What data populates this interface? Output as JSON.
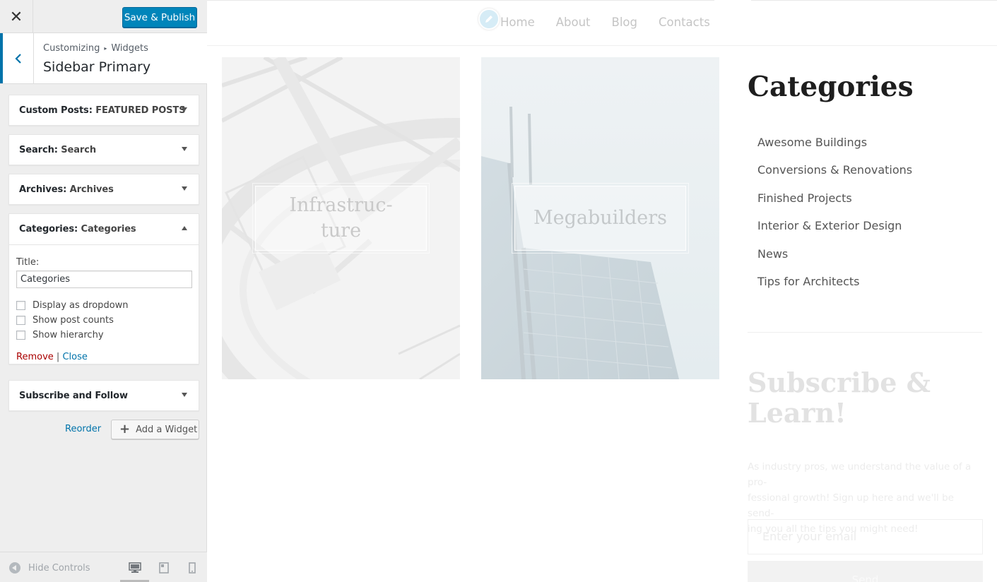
{
  "header": {
    "close_symbol": "✕",
    "publish_label": "Save & Publish"
  },
  "section": {
    "breadcrumb_root": "Customizing",
    "breadcrumb_sep": "▸",
    "breadcrumb_leaf": "Widgets",
    "title": "Sidebar Primary"
  },
  "widgets": [
    {
      "type": "Custom Posts:",
      "instance": "FEATURED POSTS",
      "expanded": false
    },
    {
      "type": "Search:",
      "instance": "Search",
      "expanded": false
    },
    {
      "type": "Archives:",
      "instance": "Archives",
      "expanded": false
    },
    {
      "type": "Categories:",
      "instance": "Categories",
      "expanded": true
    },
    {
      "type": "Subscribe and Follow",
      "instance": "",
      "expanded": false
    }
  ],
  "categories_form": {
    "title_label": "Title:",
    "title_value": "Categories",
    "options": [
      {
        "label": "Display as dropdown",
        "checked": false
      },
      {
        "label": "Show post counts",
        "checked": false
      },
      {
        "label": "Show hierarchy",
        "checked": false
      }
    ],
    "remove_label": "Remove",
    "link_sep": "|",
    "close_label": "Close"
  },
  "actions": {
    "reorder_label": "Reorder",
    "add_widget_label": "Add a Widget"
  },
  "footer": {
    "hide_controls_label": "Hide Controls",
    "devices": [
      "desktop-icon",
      "tablet-icon",
      "mobile-icon"
    ],
    "active_device": "desktop"
  },
  "preview": {
    "nav": [
      "Home",
      "About",
      "Blog",
      "Contacts"
    ],
    "cards": [
      {
        "line1": "Infrastruc-",
        "line2": "ture"
      },
      {
        "line1": "Megabuilders",
        "line2": ""
      }
    ],
    "categories_heading": "Categories",
    "categories": [
      "Awesome Buildings",
      "Conversions & Renovations",
      "Finished Projects",
      "Interior & Exterior Design",
      "News",
      "Tips for Architects"
    ],
    "subscribe_heading_l1": "Subscribe &",
    "subscribe_heading_l2": "Learn!",
    "subscribe_text_l1": "As industry pros, we understand the value of a pro-",
    "subscribe_text_l2": "fessional growth! Sign up here and we'll be send-",
    "subscribe_text_l3": "ing you all the tips you might need!",
    "email_placeholder": "Enter your email",
    "send_label": "Send"
  },
  "colors": {
    "primary_button": "#0085ba",
    "link": "#0073aa",
    "remove": "#aa0000",
    "sidebar_bg": "#eeeeee"
  }
}
